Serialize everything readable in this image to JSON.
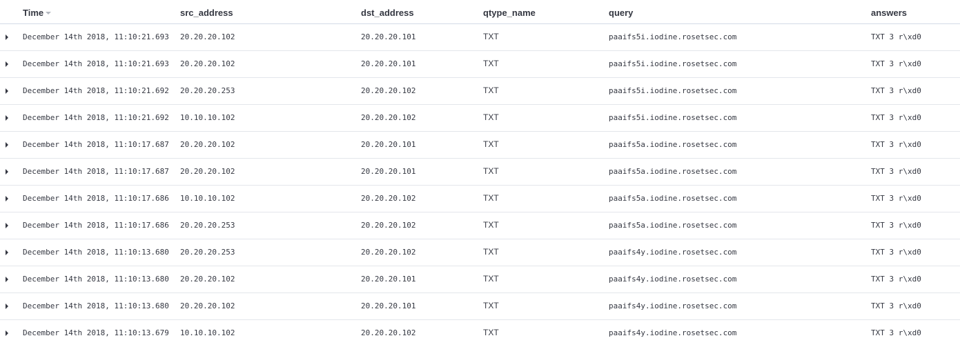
{
  "table": {
    "columns": {
      "time": "Time",
      "src_address": "src_address",
      "dst_address": "dst_address",
      "qtype_name": "qtype_name",
      "query": "query",
      "answers": "answers"
    },
    "sort_icon": "sort-down-icon",
    "rows": [
      {
        "time": "December 14th 2018, 11:10:21.693",
        "src": "20.20.20.102",
        "dst": "20.20.20.101",
        "qtype": "TXT",
        "query": "paaifs5i.iodine.rosetsec.com",
        "answers": "TXT 3 r\\xd0"
      },
      {
        "time": "December 14th 2018, 11:10:21.693",
        "src": "20.20.20.102",
        "dst": "20.20.20.101",
        "qtype": "TXT",
        "query": "paaifs5i.iodine.rosetsec.com",
        "answers": "TXT 3 r\\xd0"
      },
      {
        "time": "December 14th 2018, 11:10:21.692",
        "src": "20.20.20.253",
        "dst": "20.20.20.102",
        "qtype": "TXT",
        "query": "paaifs5i.iodine.rosetsec.com",
        "answers": "TXT 3 r\\xd0"
      },
      {
        "time": "December 14th 2018, 11:10:21.692",
        "src": "10.10.10.102",
        "dst": "20.20.20.102",
        "qtype": "TXT",
        "query": "paaifs5i.iodine.rosetsec.com",
        "answers": "TXT 3 r\\xd0"
      },
      {
        "time": "December 14th 2018, 11:10:17.687",
        "src": "20.20.20.102",
        "dst": "20.20.20.101",
        "qtype": "TXT",
        "query": "paaifs5a.iodine.rosetsec.com",
        "answers": "TXT 3 r\\xd0"
      },
      {
        "time": "December 14th 2018, 11:10:17.687",
        "src": "20.20.20.102",
        "dst": "20.20.20.101",
        "qtype": "TXT",
        "query": "paaifs5a.iodine.rosetsec.com",
        "answers": "TXT 3 r\\xd0"
      },
      {
        "time": "December 14th 2018, 11:10:17.686",
        "src": "10.10.10.102",
        "dst": "20.20.20.102",
        "qtype": "TXT",
        "query": "paaifs5a.iodine.rosetsec.com",
        "answers": "TXT 3 r\\xd0"
      },
      {
        "time": "December 14th 2018, 11:10:17.686",
        "src": "20.20.20.253",
        "dst": "20.20.20.102",
        "qtype": "TXT",
        "query": "paaifs5a.iodine.rosetsec.com",
        "answers": "TXT 3 r\\xd0"
      },
      {
        "time": "December 14th 2018, 11:10:13.680",
        "src": "20.20.20.253",
        "dst": "20.20.20.102",
        "qtype": "TXT",
        "query": "paaifs4y.iodine.rosetsec.com",
        "answers": "TXT 3 r\\xd0"
      },
      {
        "time": "December 14th 2018, 11:10:13.680",
        "src": "20.20.20.102",
        "dst": "20.20.20.101",
        "qtype": "TXT",
        "query": "paaifs4y.iodine.rosetsec.com",
        "answers": "TXT 3 r\\xd0"
      },
      {
        "time": "December 14th 2018, 11:10:13.680",
        "src": "20.20.20.102",
        "dst": "20.20.20.101",
        "qtype": "TXT",
        "query": "paaifs4y.iodine.rosetsec.com",
        "answers": "TXT 3 r\\xd0"
      },
      {
        "time": "December 14th 2018, 11:10:13.679",
        "src": "10.10.10.102",
        "dst": "20.20.20.102",
        "qtype": "TXT",
        "query": "paaifs4y.iodine.rosetsec.com",
        "answers": "TXT 3 r\\xd0"
      }
    ]
  }
}
